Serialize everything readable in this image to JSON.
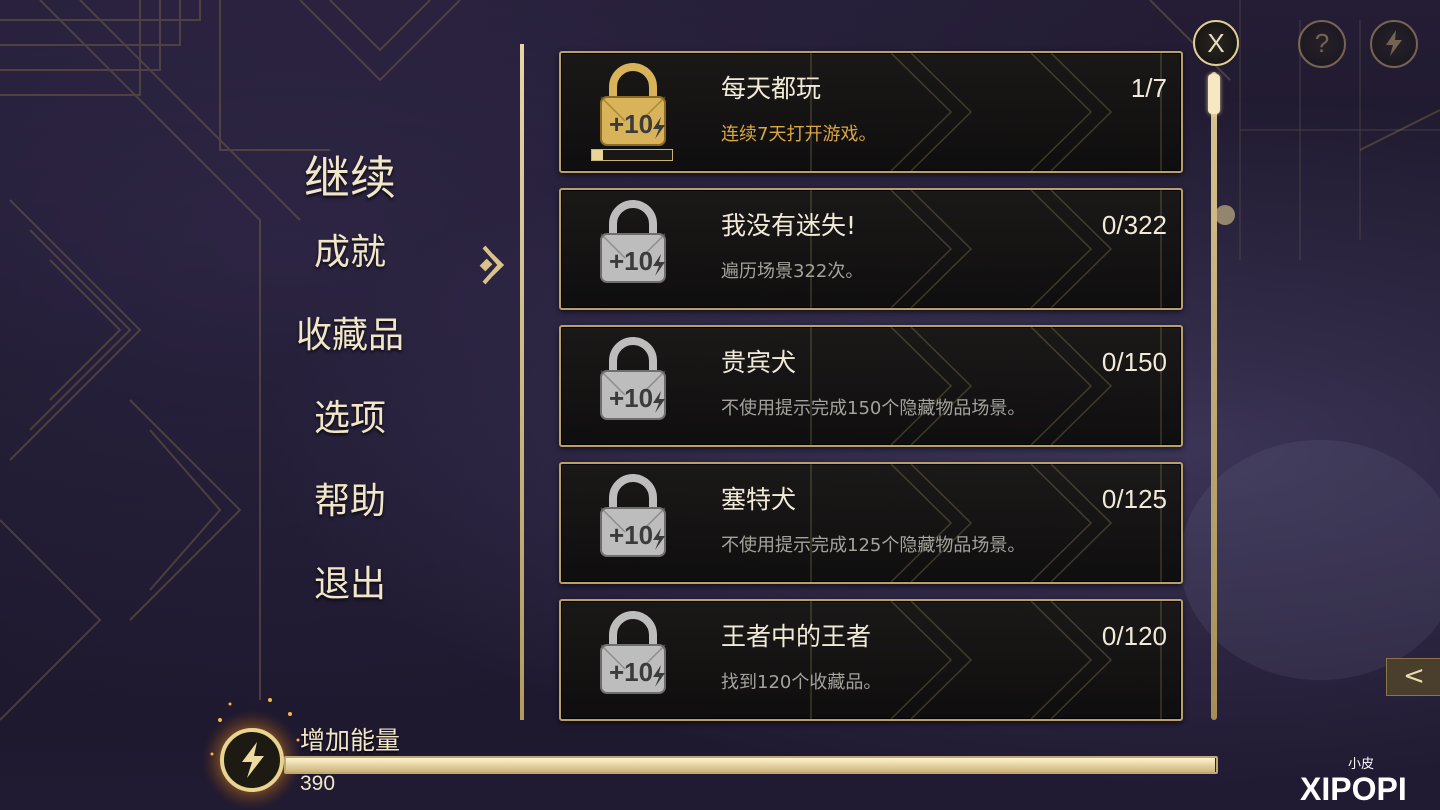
{
  "menu": {
    "items": [
      {
        "label": "继续"
      },
      {
        "label": "成就"
      },
      {
        "label": "收藏品"
      },
      {
        "label": "选项"
      },
      {
        "label": "帮助"
      },
      {
        "label": "退出"
      }
    ],
    "selected": "成就"
  },
  "achievements": [
    {
      "title": "每天都玩",
      "progress": "1/7",
      "description": "连续7天打开游戏。",
      "reward": "+10",
      "progress_fraction": 0.14,
      "highlight": true
    },
    {
      "title": "我没有迷失!",
      "progress": "0/322",
      "description": "遍历场景322次。",
      "reward": "+10",
      "highlight": false
    },
    {
      "title": "贵宾犬",
      "progress": "0/150",
      "description": "不使用提示完成150个隐藏物品场景。",
      "reward": "+10",
      "highlight": false
    },
    {
      "title": "塞特犬",
      "progress": "0/125",
      "description": "不使用提示完成125个隐藏物品场景。",
      "reward": "+10",
      "highlight": false
    },
    {
      "title": "王者中的王者",
      "progress": "0/120",
      "description": "找到120个收藏品。",
      "reward": "+10",
      "highlight": false
    }
  ],
  "energy": {
    "label": "增加能量",
    "value": "390",
    "fill_fraction": 0.999
  },
  "buttons": {
    "close": "X",
    "help": "?",
    "side_tab": "<"
  },
  "icons": {
    "close": "close-icon",
    "help": "help-icon",
    "energy": "lightning-icon",
    "lock": "lock-icon",
    "selector": "chevron-right-icon",
    "side_tab": "chevron-left-icon"
  },
  "watermark": {
    "line1": "小皮",
    "line2": "XIPOPI"
  },
  "colors": {
    "gold": "#b9a06a",
    "text_light": "#f1ead8",
    "desc_gray": "#a5a29c",
    "desc_gold": "#d9a743"
  }
}
